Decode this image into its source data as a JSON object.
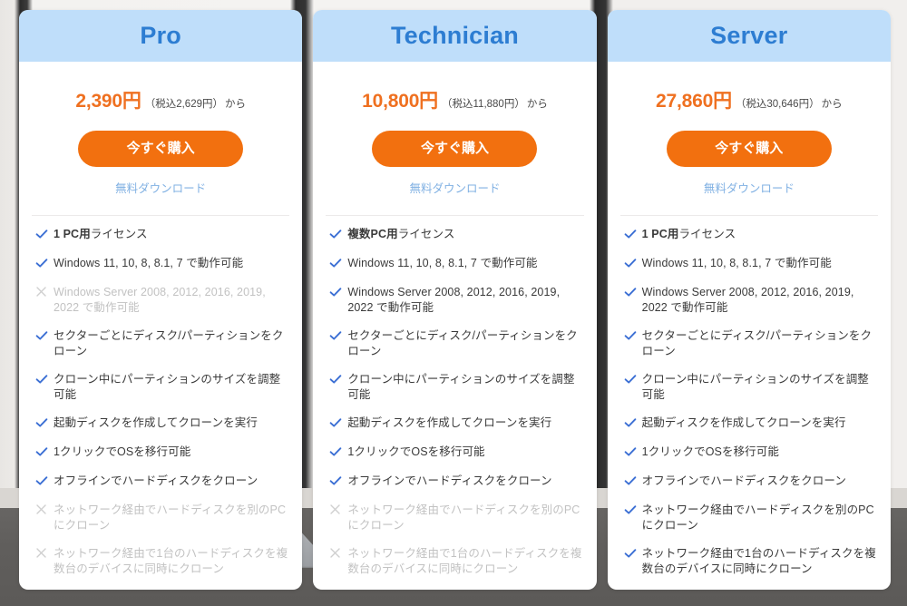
{
  "colors": {
    "header_bg": "#bfdefa",
    "plan_title": "#2d7dd2",
    "price": "#ef7020",
    "button": "#f2700f",
    "free_link": "#81b1e3",
    "check": "#3b6fd4",
    "cross": "#cfcfcf",
    "feature_text": "#3a3a3a",
    "feature_text_disabled": "#c2c2c2",
    "card_bg": "#ffffff",
    "page_bg": "#f2f1ef"
  },
  "common": {
    "buy_label": "今すぐ購入",
    "free_download_label": "無料ダウンロード",
    "price_from_suffix": "から",
    "check_icon": "check-icon",
    "cross_icon": "cross-icon"
  },
  "plans": [
    {
      "name": "Pro",
      "price": "2,390円",
      "tax": "（税込2,629円）",
      "from": "から",
      "buy_label": "今すぐ購入",
      "free_download_label": "無料ダウンロード",
      "features": [
        {
          "strong": "1 PC用",
          "rest": "ライセンス",
          "enabled": true
        },
        {
          "strong": "",
          "rest": "Windows 11, 10, 8, 8.1, 7 で動作可能",
          "enabled": true
        },
        {
          "strong": "",
          "rest": "Windows Server 2008, 2012, 2016, 2019, 2022 で動作可能",
          "enabled": false
        },
        {
          "strong": "",
          "rest": "セクターごとにディスク/パーティションをクローン",
          "enabled": true
        },
        {
          "strong": "",
          "rest": "クローン中にパーティションのサイズを調整可能",
          "enabled": true
        },
        {
          "strong": "",
          "rest": "起動ディスクを作成してクローンを実行",
          "enabled": true
        },
        {
          "strong": "",
          "rest": "1クリックでOSを移行可能",
          "enabled": true
        },
        {
          "strong": "",
          "rest": "オフラインでハードディスクをクローン",
          "enabled": true
        },
        {
          "strong": "",
          "rest": "ネットワーク経由でハードディスクを別のPCにクローン",
          "enabled": false
        },
        {
          "strong": "",
          "rest": "ネットワーク経由で1台のハードディスクを複数台のデバイスに同時にクローン",
          "enabled": false
        }
      ]
    },
    {
      "name": "Technician",
      "price": "10,800円",
      "tax": "（税込11,880円）",
      "from": "から",
      "buy_label": "今すぐ購入",
      "free_download_label": "無料ダウンロード",
      "features": [
        {
          "strong": "複数PC用",
          "rest": "ライセンス",
          "enabled": true
        },
        {
          "strong": "",
          "rest": "Windows 11, 10, 8, 8.1, 7 で動作可能",
          "enabled": true
        },
        {
          "strong": "",
          "rest": "Windows Server 2008, 2012, 2016, 2019, 2022 で動作可能",
          "enabled": true
        },
        {
          "strong": "",
          "rest": "セクターごとにディスク/パーティションをクローン",
          "enabled": true
        },
        {
          "strong": "",
          "rest": "クローン中にパーティションのサイズを調整可能",
          "enabled": true
        },
        {
          "strong": "",
          "rest": "起動ディスクを作成してクローンを実行",
          "enabled": true
        },
        {
          "strong": "",
          "rest": "1クリックでOSを移行可能",
          "enabled": true
        },
        {
          "strong": "",
          "rest": "オフラインでハードディスクをクローン",
          "enabled": true
        },
        {
          "strong": "",
          "rest": "ネットワーク経由でハードディスクを別のPCにクローン",
          "enabled": false
        },
        {
          "strong": "",
          "rest": "ネットワーク経由で1台のハードディスクを複数台のデバイスに同時にクローン",
          "enabled": false
        }
      ]
    },
    {
      "name": "Server",
      "price": "27,860円",
      "tax": "（税込30,646円）",
      "from": "から",
      "buy_label": "今すぐ購入",
      "free_download_label": "無料ダウンロード",
      "features": [
        {
          "strong": "1 PC用",
          "rest": "ライセンス",
          "enabled": true
        },
        {
          "strong": "",
          "rest": "Windows 11, 10, 8, 8.1, 7 で動作可能",
          "enabled": true
        },
        {
          "strong": "",
          "rest": "Windows Server 2008, 2012, 2016, 2019, 2022 で動作可能",
          "enabled": true
        },
        {
          "strong": "",
          "rest": "セクターごとにディスク/パーティションをクローン",
          "enabled": true
        },
        {
          "strong": "",
          "rest": "クローン中にパーティションのサイズを調整可能",
          "enabled": true
        },
        {
          "strong": "",
          "rest": "起動ディスクを作成してクローンを実行",
          "enabled": true
        },
        {
          "strong": "",
          "rest": "1クリックでOSを移行可能",
          "enabled": true
        },
        {
          "strong": "",
          "rest": "オフラインでハードディスクをクローン",
          "enabled": true
        },
        {
          "strong": "",
          "rest": "ネットワーク経由でハードディスクを別のPCにクローン",
          "enabled": true
        },
        {
          "strong": "",
          "rest": "ネットワーク経由で1台のハードディスクを複数台のデバイスに同時にクローン",
          "enabled": true
        }
      ]
    }
  ]
}
